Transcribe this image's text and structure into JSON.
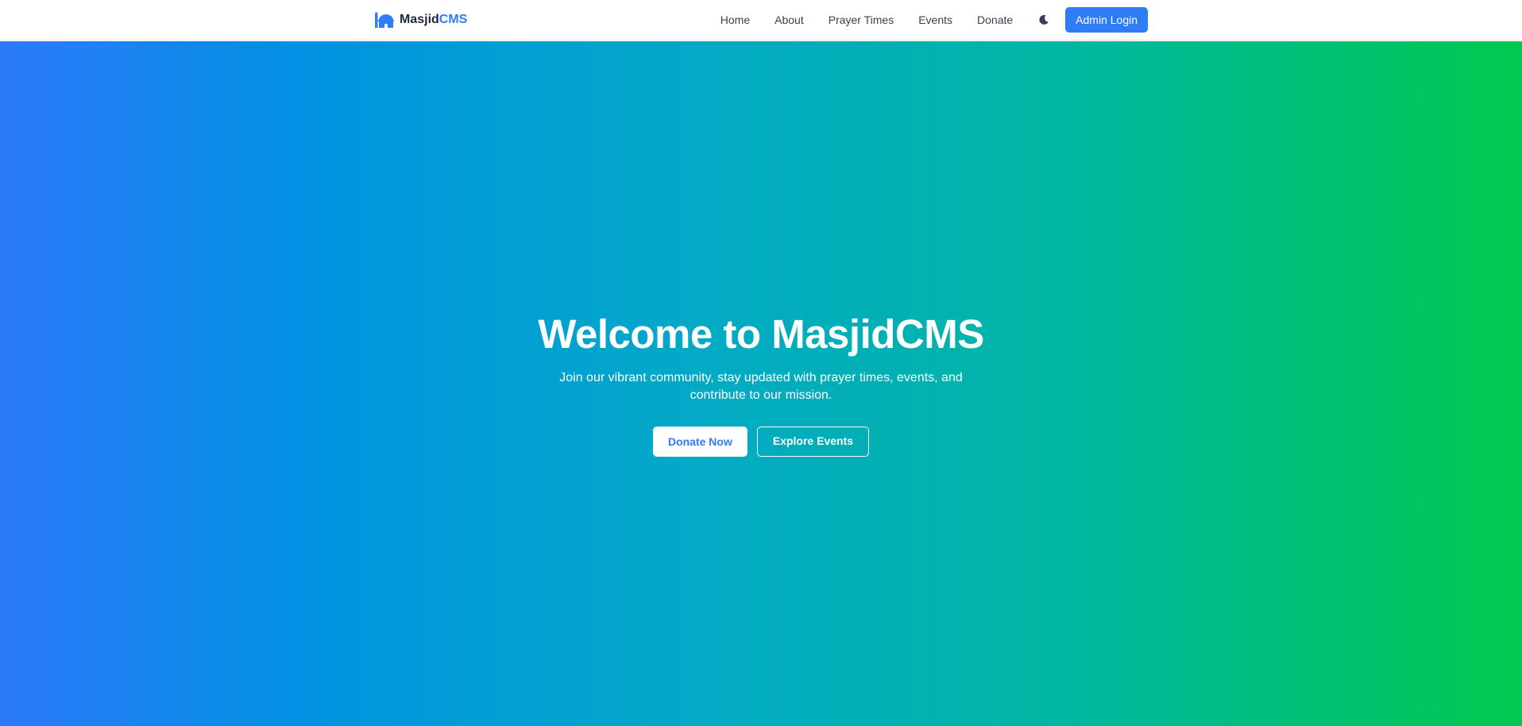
{
  "brand": {
    "name_part1": "Masjid",
    "name_part2": "CMS",
    "icon": "mosque-icon",
    "accent_color": "#2f7df6"
  },
  "nav": {
    "links": [
      "Home",
      "About",
      "Prayer Times",
      "Events",
      "Donate"
    ],
    "theme_icon": "moon-icon",
    "admin_label": "Admin Login"
  },
  "hero": {
    "title": "Welcome to MasjidCMS",
    "subtitle": "Join our vibrant community, stay updated with prayer times, events, and contribute to our mission.",
    "primary_button": "Donate Now",
    "secondary_button": "Explore Events",
    "gradient_start": "#2d79fb",
    "gradient_end": "#02c84f"
  }
}
